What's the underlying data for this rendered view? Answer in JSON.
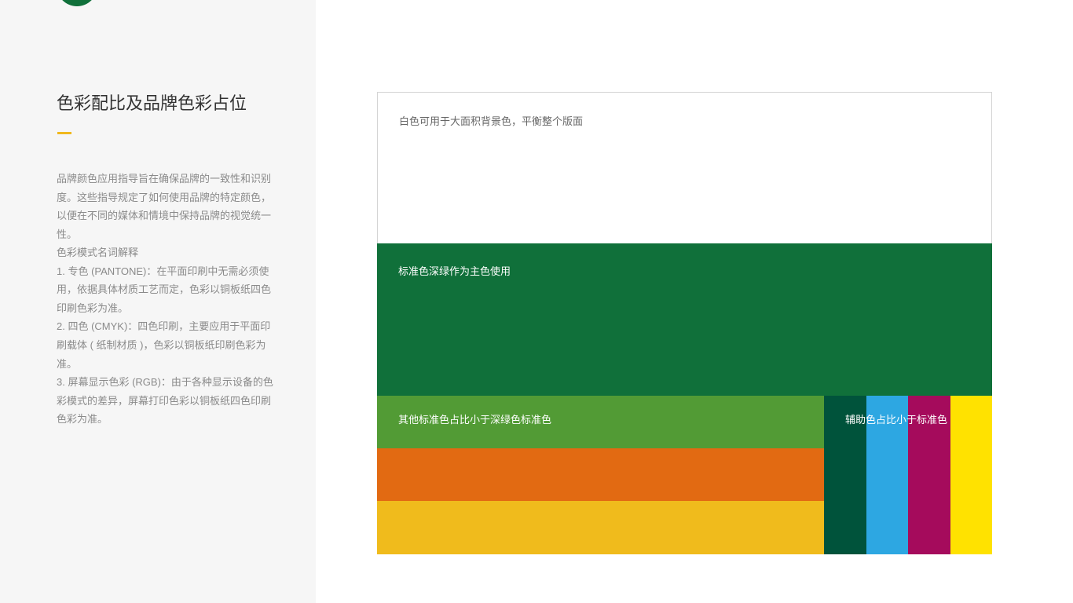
{
  "colors": {
    "brand_green": "#10703a",
    "accent_yellow": "#f0b81d",
    "sidebar_bg": "#f6f6f6"
  },
  "sidebar": {
    "title": "色彩配比及品牌色彩占位",
    "description": "品牌颜色应用指导旨在确保品牌的一致性和识别度。这些指导规定了如何使用品牌的特定颜色，以便在不同的媒体和情境中保持品牌的视觉统一性。",
    "modes": {
      "heading": "色彩模式名词解释",
      "items": [
        "1. 专色 (PANTONE)：在平面印刷中无需必须使用，依据具体材质工艺而定，色彩以铜板纸四色印刷色彩为准。",
        "2. 四色 (CMYK)：四色印刷，主要应用于平面印刷载体 ( 纸制材质 )，色彩以铜板纸印刷色彩为准。",
        "3. 屏幕显示色彩 (RGB)：由于各种显示设备的色彩模式的差异，屏幕打印色彩以铜板纸四色印刷色彩为准。"
      ]
    }
  },
  "proportion": {
    "white": {
      "label": "白色可用于大面积背景色，平衡整个版面",
      "color": "#ffffff"
    },
    "primary": {
      "label": "标准色深绿作为主色使用",
      "color": "#10703a"
    },
    "standard": {
      "label": "其他标准色占比小于深绿色标准色",
      "colors": [
        "#529b35",
        "#e26a12",
        "#f0bb1c"
      ]
    },
    "auxiliary": {
      "label": "辅助色占比小于标准色",
      "colors": [
        "#00533b",
        "#2da7e2",
        "#a50b5c",
        "#ffe200"
      ]
    }
  }
}
